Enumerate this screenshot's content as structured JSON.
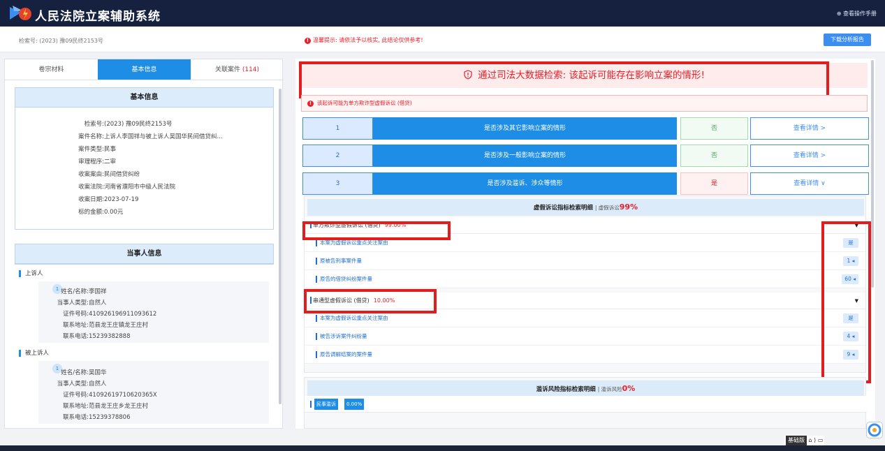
{
  "header": {
    "app_title": "人民法院立案辅助系统",
    "manual_link": "⊕ 查看操作手册"
  },
  "infobar": {
    "search_no": "检索号: (2023) 豫09民终2153号",
    "tip": "温馨提示: 请依法予以核实, 此结论仅供参考!",
    "download_button": "下载分析报告"
  },
  "tabs": [
    {
      "label": "卷宗材料"
    },
    {
      "label": "基本信息"
    },
    {
      "label": "关联案件",
      "count": "(114)"
    }
  ],
  "basic_info": {
    "title": "基本信息",
    "fields": [
      {
        "k": "检索号:",
        "v": "(2023) 豫09民终2153号"
      },
      {
        "k": "案件名称:",
        "v": "上诉人李国祥与被上诉人吴国华民间借贷纠..."
      },
      {
        "k": "案件类型:",
        "v": "民事"
      },
      {
        "k": "审理程序:",
        "v": "二审"
      },
      {
        "k": "收案案由:",
        "v": "民间借贷纠纷"
      },
      {
        "k": "收案法院:",
        "v": "河南省濮阳市中级人民法院"
      },
      {
        "k": "收案日期:",
        "v": "2023-07-19"
      },
      {
        "k": "标的金额:",
        "v": "0.00元"
      }
    ]
  },
  "party_info": {
    "title": "当事人信息",
    "appellant_label": "上诉人",
    "appellant": {
      "index": "1",
      "fields": [
        {
          "k": "姓名/名称:",
          "v": "李国祥"
        },
        {
          "k": "当事人类型:",
          "v": "自然人"
        },
        {
          "k": "证件号码:",
          "v": "410926196911093612"
        },
        {
          "k": "联系地址:",
          "v": "范县龙王庄镇龙王庄村"
        },
        {
          "k": "联系电话:",
          "v": "15239382888"
        }
      ]
    },
    "appellee_label": "被上诉人",
    "appellee": {
      "index": "1",
      "fields": [
        {
          "k": "姓名/名称:",
          "v": "吴国华"
        },
        {
          "k": "当事人类型:",
          "v": "自然人"
        },
        {
          "k": "证件号码:",
          "v": "41092619710620365X"
        },
        {
          "k": "联系地址:",
          "v": "范县龙王庄乡龙王庄村"
        },
        {
          "k": "联系电话:",
          "v": "15239378806"
        }
      ]
    }
  },
  "result": {
    "banner": "通过司法大数据检索: 该起诉可能存在影响立案的情形!",
    "alert": "该起诉可能为单方欺诈型虚假诉讼 (借贷)",
    "rows": [
      {
        "num": "1",
        "text": "是否涉及其它影响立案的情形",
        "answer": "否",
        "link": "查看详情 >"
      },
      {
        "num": "2",
        "text": "是否涉及一般影响立案的情形",
        "answer": "否",
        "link": "查看详情 >"
      },
      {
        "num": "3",
        "text": "是否涉及滥诉、涉众等情形",
        "answer": "是",
        "link": "查看详情 ∨"
      }
    ]
  },
  "false_litigation": {
    "title": "虚假诉讼指标检索明细",
    "sub": "虚假诉讼",
    "pct": "99%",
    "groups": [
      {
        "name": "单方欺诈型虚假诉讼 (借贷)",
        "pct": "99.00%",
        "items": [
          {
            "label": "本案为虚假诉讼重点关注案由",
            "value": "是"
          },
          {
            "label": "原被告刑事案件量",
            "value": "1 ◂"
          },
          {
            "label": "原告的借贷纠纷案件量",
            "value": "60 ◂"
          }
        ]
      },
      {
        "name": "串通型虚假诉讼 (借贷)",
        "pct": "10.00%",
        "items": [
          {
            "label": "本案为虚假诉讼重点关注案由",
            "value": "是"
          },
          {
            "label": "被告涉诉案件纠纷量",
            "value": "4 ◂"
          },
          {
            "label": "原告调解结案的案件量",
            "value": "9 ◂"
          }
        ]
      }
    ]
  },
  "abuse": {
    "title": "滥诉风险指标检索明细",
    "sub": "滥诉风险",
    "pct": "0%",
    "chip_label": "民事滥诉",
    "chip_value": "0.00%"
  },
  "footer": {
    "ime_label": "基础版",
    "ime_icons": "⌂ ⟩ ▭"
  }
}
